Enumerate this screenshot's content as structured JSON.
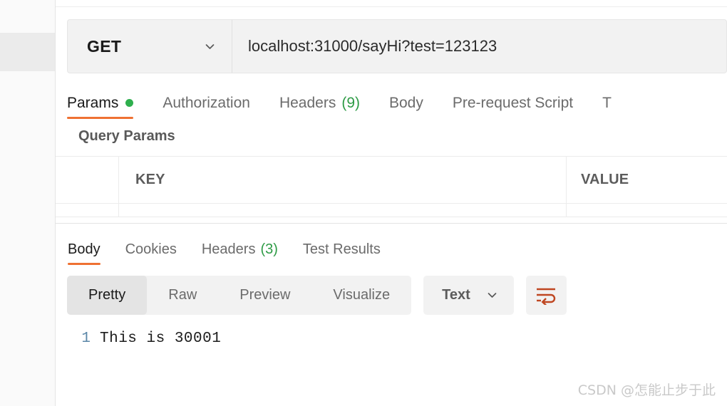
{
  "request": {
    "method": "GET",
    "url": "localhost:31000/sayHi?test=123123",
    "tabs": [
      {
        "label": "Params",
        "badge_dot": true
      },
      {
        "label": "Authorization"
      },
      {
        "label": "Headers",
        "count": "(9)"
      },
      {
        "label": "Body"
      },
      {
        "label": "Pre-request Script"
      },
      {
        "label": "T"
      }
    ],
    "params_section_title": "Query Params",
    "table_headers": {
      "key": "KEY",
      "value": "VALUE"
    }
  },
  "response": {
    "tabs": [
      {
        "label": "Body"
      },
      {
        "label": "Cookies"
      },
      {
        "label": "Headers",
        "count": "(3)"
      },
      {
        "label": "Test Results"
      }
    ],
    "view_modes": [
      "Pretty",
      "Raw",
      "Preview",
      "Visualize"
    ],
    "content_type": "Text",
    "wrap_icon": "wrap-text-icon",
    "body_lines": [
      {
        "number": "1",
        "text": "This is 30001"
      }
    ]
  },
  "watermark": "CSDN @怎能止步于此",
  "colors": {
    "accent": "#ef7132",
    "badge_green": "#2eaf4d",
    "count_green": "#2e9b46",
    "wrap_icon": "#bf4722",
    "gutter": "#5b87a8"
  }
}
